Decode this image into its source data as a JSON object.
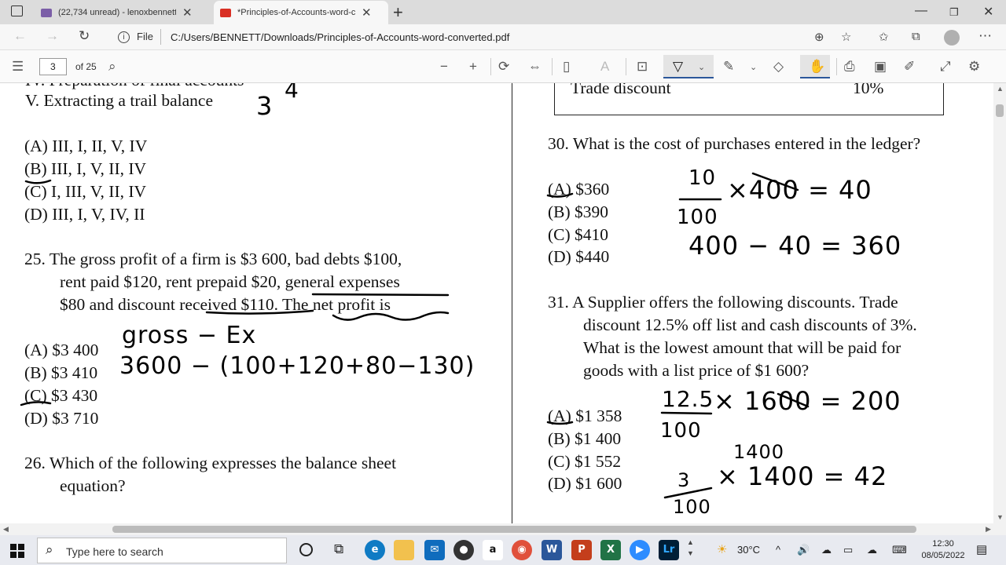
{
  "tabs": [
    {
      "title": "(22,734 unread) - lenoxbennett@",
      "icon": "mail-icon",
      "active": false
    },
    {
      "title": "*Principles-of-Accounts-word-co",
      "icon": "pdf-icon",
      "active": true
    }
  ],
  "address": {
    "info_label": "File",
    "url": "C:/Users/BENNETT/Downloads/Principles-of-Accounts-word-converted.pdf"
  },
  "pdf_toolbar": {
    "current_page": "3",
    "page_of": "of 25"
  },
  "document": {
    "left": {
      "item_iv": "IV. Preparation of final accounts",
      "item_v": "V.  Extracting a trail balance",
      "q24_options": [
        "(A) III, I, II, V, IV",
        "(B) III, I, V, II, IV",
        "(C) I, III, V, II, IV",
        "(D) III, I, V, IV, II"
      ],
      "q25_line1": "25. The gross profit of a firm is $3 600, bad debts $100,",
      "q25_line2": "rent paid $120, rent prepaid $20, general expenses",
      "q25_line3": "$80 and discount received $110.  The net profit is",
      "q25_options": [
        "(A) $3 400",
        "(B) $3 410",
        "(C) $3 430",
        "(D) $3 710"
      ],
      "q26_line1": "26. Which of the following expresses the balance sheet",
      "q26_line2": "equation?"
    },
    "right": {
      "table_label": "Trade discount",
      "table_value": "10%",
      "q30": "30. What is the cost of purchases entered in the ledger?",
      "q30_options": [
        "(A) $360",
        "(B) $390",
        "(C) $410",
        "(D) $440"
      ],
      "q31_line1": "31. A Supplier offers the following discounts. Trade",
      "q31_line2": "discount 12.5% off list and cash discounts of 3%.",
      "q31_line3": "What is the lowest amount that will be paid for",
      "q31_line4": "goods with a list price of $1 600?",
      "q31_options": [
        "(A) $1 358",
        "(B) $1 400",
        "(C) $1 552",
        "(D) $1 600"
      ]
    },
    "handwriting": {
      "h_34": "3",
      "h_4": "4",
      "h_gross": "gross − Ex",
      "h_calc": "3600 − (100+120+80−130)",
      "h_10": "10",
      "h_100a": "100",
      "h_x400": "×400 = 40",
      "h_360": "400 − 40 = 360",
      "h_125": "12.5",
      "h_100b": "100",
      "h_x1600": "× 1600 = 200",
      "h_1400": "1400",
      "h_3": "3",
      "h_100c": "100",
      "h_x1400": "× 1400 = 42"
    }
  },
  "taskbar": {
    "search_placeholder": "Type here to search",
    "weather": "30°C",
    "time": "12:30",
    "date": "08/05/2022"
  },
  "colors": {
    "accent": "#2b579a",
    "pdf_red": "#d93025",
    "mail_purple": "#7b5ea7"
  }
}
